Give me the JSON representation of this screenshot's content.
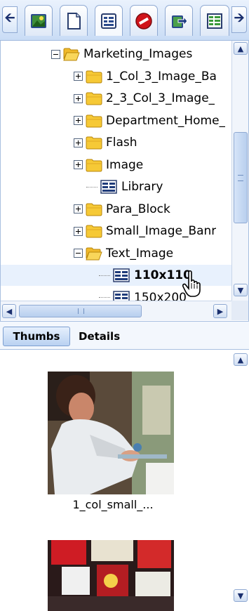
{
  "toolbar": {
    "back_icon": "left-arrow-icon",
    "forward_icon": "right-arrow-icon",
    "tabs": [
      {
        "icon": "image-tab-icon",
        "active": false
      },
      {
        "icon": "page-tab-icon",
        "active": false
      },
      {
        "icon": "template-tab-icon",
        "active": true
      },
      {
        "icon": "no-entry-tab-icon",
        "active": false
      },
      {
        "icon": "export-tab-icon",
        "active": false
      },
      {
        "icon": "grid-tab-icon",
        "active": false
      }
    ]
  },
  "tree": {
    "items": [
      {
        "label": "Marketing_Images",
        "type": "folder",
        "expander": "minus"
      },
      {
        "label": "1_Col_3_Image_Ba",
        "type": "folder",
        "expander": "plus"
      },
      {
        "label": "2_3_Col_3_Image_",
        "type": "folder",
        "expander": "plus"
      },
      {
        "label": "Department_Home_",
        "type": "folder",
        "expander": "plus"
      },
      {
        "label": "Flash",
        "type": "folder",
        "expander": "plus"
      },
      {
        "label": "Image",
        "type": "folder",
        "expander": "plus"
      },
      {
        "label": "Library",
        "type": "template",
        "expander": "none"
      },
      {
        "label": "Para_Block",
        "type": "folder",
        "expander": "plus"
      },
      {
        "label": "Small_Image_Banr",
        "type": "folder",
        "expander": "plus"
      },
      {
        "label": "Text_Image",
        "type": "folder",
        "expander": "minus"
      },
      {
        "label": "110x110",
        "type": "template",
        "expander": "none",
        "selected": true
      },
      {
        "label": "150x200",
        "type": "template",
        "expander": "none"
      }
    ],
    "scroll_up_icon": "chevron-up-icon",
    "scroll_down_icon": "chevron-down-icon",
    "scroll_left_icon": "chevron-left-icon",
    "scroll_right_icon": "chevron-right-icon",
    "cursor_icon": "hand-pointer-icon"
  },
  "view_tabs": {
    "thumbs_label": "Thumbs",
    "details_label": "Details",
    "active": "Thumbs"
  },
  "thumbnails": [
    {
      "caption": "1_col_small_...",
      "image": "photo-person-in-lab"
    },
    {
      "caption": "",
      "image": "photo-red-posters"
    }
  ],
  "colors": {
    "toolbar_bg": "#c9dcf5",
    "selection_bg": "#e8f1fd",
    "active_tab_bg": "#b9d1f1",
    "folder_yellow": "#f6c936",
    "border_blue": "#8fa9d2"
  }
}
